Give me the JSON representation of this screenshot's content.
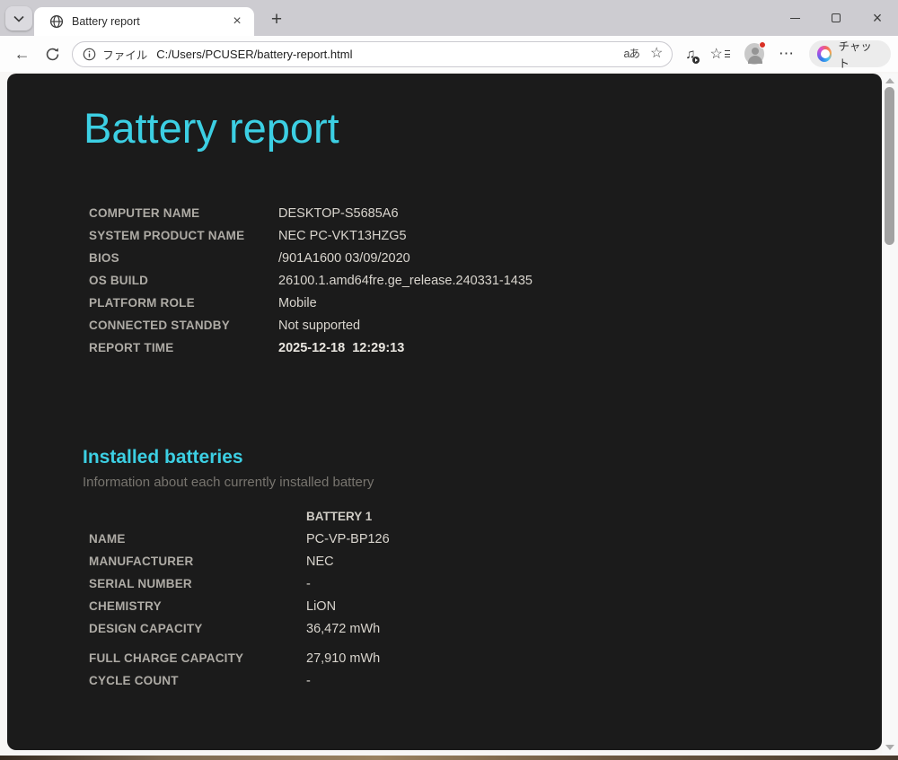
{
  "browser": {
    "tab_title": "Battery report",
    "address": {
      "scheme_label": "ファイル",
      "url": "C:/Users/PCUSER/battery-report.html"
    },
    "chat_label": "チャット"
  },
  "icons": {
    "back": "←",
    "new_tab": "+",
    "close": "×",
    "star": "☆",
    "translate": "aあ",
    "media_note": "♫",
    "more": "⋯"
  },
  "colors": {
    "accent_cyan": "#3ccfe3",
    "page_bg": "#1b1b1b",
    "tabstrip_bg": "#cdccd1"
  },
  "page": {
    "title": "Battery report",
    "system_info": {
      "rows": [
        {
          "label": "COMPUTER NAME",
          "value": "DESKTOP-S5685A6"
        },
        {
          "label": "SYSTEM PRODUCT NAME",
          "value": "NEC PC-VKT13HZG5"
        },
        {
          "label": "BIOS",
          "value": "/901A1600 03/09/2020"
        },
        {
          "label": "OS BUILD",
          "value": "26100.1.amd64fre.ge_release.240331-1435"
        },
        {
          "label": "PLATFORM ROLE",
          "value": "Mobile"
        },
        {
          "label": "CONNECTED STANDBY",
          "value": "Not supported"
        },
        {
          "label": "REPORT TIME",
          "value": "2025-12-18  12:29:13"
        }
      ]
    },
    "installed_batteries": {
      "heading": "Installed batteries",
      "subtitle": "Information about each currently installed battery",
      "column_header": "BATTERY 1",
      "rows": [
        {
          "label": "NAME",
          "value": "PC-VP-BP126"
        },
        {
          "label": "MANUFACTURER",
          "value": "NEC"
        },
        {
          "label": "SERIAL NUMBER",
          "value": "-"
        },
        {
          "label": "CHEMISTRY",
          "value": "LiON"
        },
        {
          "label": "DESIGN CAPACITY",
          "value": "36,472 mWh"
        },
        {
          "label": "FULL CHARGE CAPACITY",
          "value": "27,910 mWh"
        },
        {
          "label": "CYCLE COUNT",
          "value": "-"
        }
      ]
    }
  }
}
